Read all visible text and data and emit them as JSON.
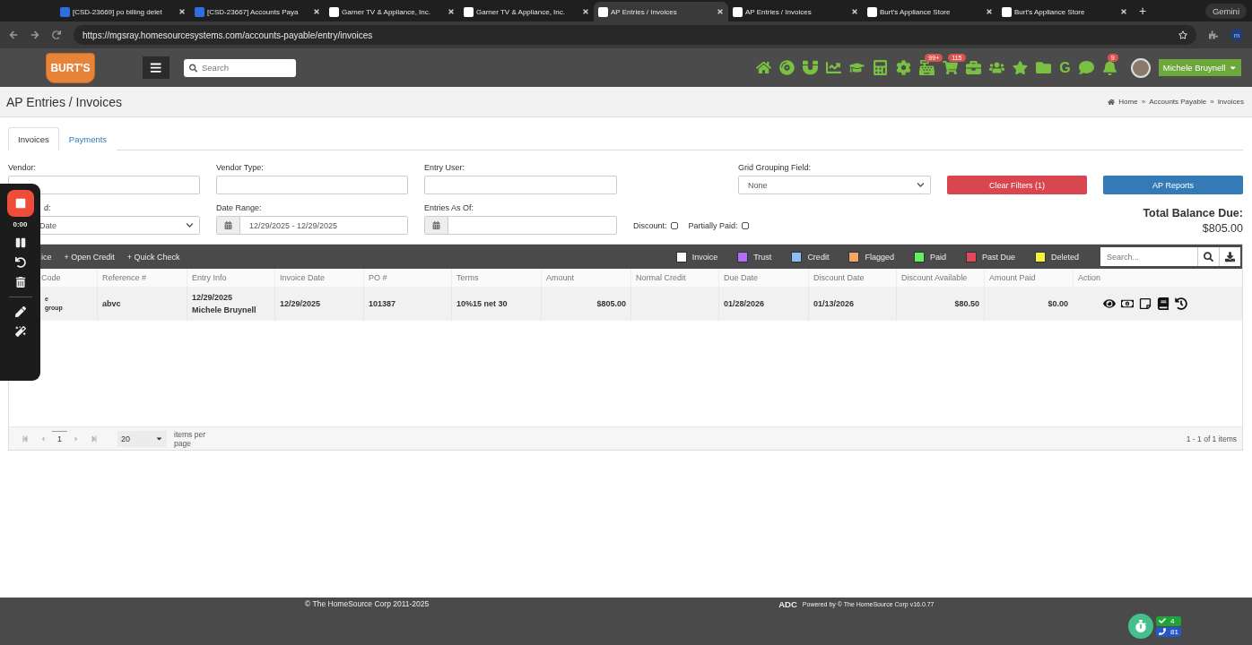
{
  "browser": {
    "tabs": [
      {
        "kind": "ticket",
        "title": "[CSD-23669] po billing delet",
        "selected": false
      },
      {
        "kind": "ticket",
        "title": "[CSD-23667] Accounts Paya",
        "selected": false
      },
      {
        "kind": "site",
        "title": "Garner TV & Appliance, Inc.",
        "selected": false
      },
      {
        "kind": "site",
        "title": "Garner TV & Appliance, Inc.",
        "selected": false
      },
      {
        "kind": "site",
        "title": "AP Entries / Invoices",
        "selected": true
      },
      {
        "kind": "site",
        "title": "AP Entries / Invoices",
        "selected": false
      },
      {
        "kind": "site",
        "title": "Burt's Appliance Store",
        "selected": false
      },
      {
        "kind": "site",
        "title": "Burt's Appliance Store",
        "selected": false
      }
    ],
    "new_tab": "+",
    "gemini": "Gemini",
    "url": "https://mgsray.homesourcesystems.com/accounts-payable/entry/invoices",
    "profile": "m"
  },
  "header": {
    "logo": "BURT'S",
    "search_placeholder": "Search",
    "nav": [
      {
        "kind": "home"
      },
      {
        "kind": "disc"
      },
      {
        "kind": "magnet"
      },
      {
        "kind": "chart"
      },
      {
        "kind": "cap"
      },
      {
        "kind": "calculator"
      },
      {
        "kind": "gear"
      },
      {
        "kind": "register",
        "badge": "99+"
      },
      {
        "kind": "cart",
        "badge": "115"
      },
      {
        "kind": "briefcase"
      },
      {
        "kind": "users"
      },
      {
        "kind": "star"
      },
      {
        "kind": "folder"
      },
      {
        "kind": "letter",
        "text": "G"
      },
      {
        "kind": "chat"
      },
      {
        "kind": "bell",
        "badge": "9"
      }
    ],
    "user": "Michele Bruynell"
  },
  "page": {
    "title": "AP Entries / Invoices",
    "breadcrumb": [
      "Home",
      "Accounts Payable",
      "Invoices"
    ],
    "separator": "»"
  },
  "tabs": [
    {
      "label": "Invoices",
      "selected": true
    },
    {
      "label": "Payments",
      "selected": false
    }
  ],
  "filters": {
    "vendor": "Vendor:",
    "vendor_type": "Vendor Type:",
    "entry_user": "Entry User:",
    "grouping_label": "Grid Grouping Field:",
    "grouping_value": "None",
    "clear": "Clear Filters (1)",
    "reports": "AP Reports",
    "date_field_label": "d:",
    "date_field_value": "Date",
    "date_range_label": "Date Range:",
    "date_range_value": "12/29/2025 - 12/29/2025",
    "as_of_label": "Entries As Of:",
    "checks": [
      {
        "label": "Discount:",
        "checked": false
      },
      {
        "label": "Partially Paid:",
        "checked": false
      }
    ],
    "total_label": "Total Balance Due:",
    "total_value": "$805.00"
  },
  "toolbar": {
    "actions": [
      {
        "label": "ice"
      },
      {
        "prefix": "+",
        "label": "Open Credit"
      },
      {
        "prefix": "+",
        "label": "Quick Check"
      }
    ],
    "legend": [
      {
        "label": "Invoice",
        "color": "#ffffff"
      },
      {
        "label": "Trust",
        "color": "#b26ef5"
      },
      {
        "label": "Credit",
        "color": "#8cbff5"
      },
      {
        "label": "Flagged",
        "color": "#f2a766"
      },
      {
        "label": "Paid",
        "color": "#67ee67"
      },
      {
        "label": "Past Due",
        "color": "#e0495a"
      },
      {
        "label": "Deleted",
        "color": "#f5f23a"
      }
    ],
    "search_placeholder": "Search..."
  },
  "table": {
    "columns": [
      {
        "label": "Code",
        "kind": "text"
      },
      {
        "label": "Reference #",
        "kind": "text"
      },
      {
        "label": "Entry Info",
        "kind": "text"
      },
      {
        "label": "Invoice Date",
        "kind": "text"
      },
      {
        "label": "PO #",
        "kind": "text"
      },
      {
        "label": "Terms",
        "kind": "text"
      },
      {
        "label": "Amount",
        "kind": "money"
      },
      {
        "label": "Normal Credit",
        "kind": "money"
      },
      {
        "label": "Due Date",
        "kind": "text"
      },
      {
        "label": "Discount Date",
        "kind": "text"
      },
      {
        "label": "Discount Available",
        "kind": "money"
      },
      {
        "label": "Amount Paid",
        "kind": "money"
      },
      {
        "label": "Action",
        "kind": "actions"
      }
    ],
    "rows": [
      {
        "cells": [
          "e\ngroup",
          "abvc",
          "12/29/2025\nMichele Bruynell",
          "12/29/2025",
          "101387",
          "10%15 net 30",
          "$805.00",
          "",
          "01/28/2026",
          "01/13/2026",
          "$80.50",
          "$0.00"
        ]
      }
    ]
  },
  "pager": {
    "page": "1",
    "page_size": "20",
    "items_label": "items per page",
    "summary": "1 - 1 of 1 items"
  },
  "recorder": {
    "time": "0:00"
  },
  "footer": {
    "copyright": "© The HomeSource Corp 2011-2025",
    "brand": "ADC",
    "powered": "Powered by © The HomeSource Corp  v16.0.77",
    "checks": "4",
    "calls": "81"
  }
}
